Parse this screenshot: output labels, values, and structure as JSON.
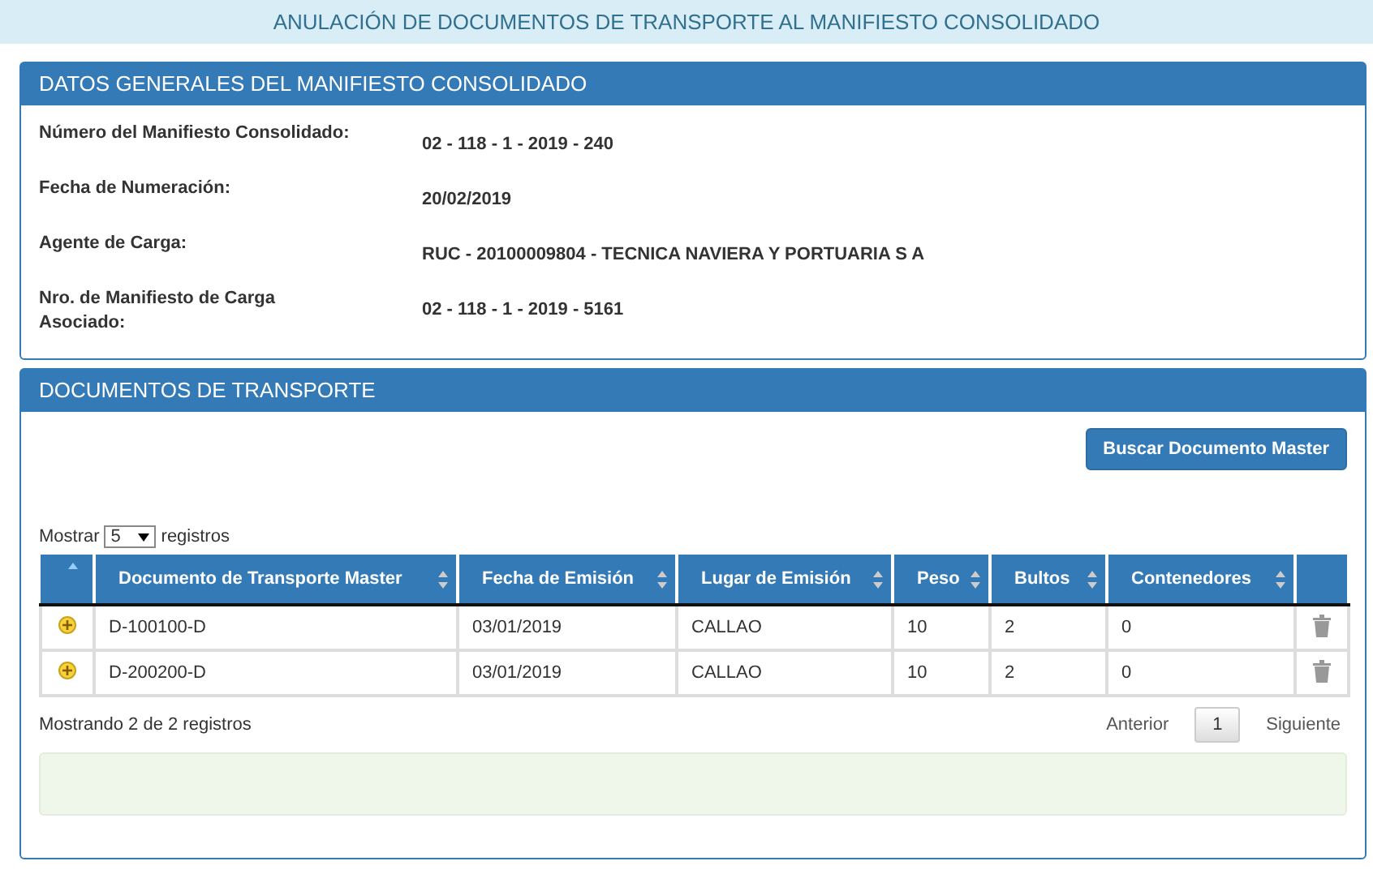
{
  "page_title": "ANULACIÓN DE DOCUMENTOS DE TRANSPORTE AL MANIFIESTO CONSOLIDADO",
  "general": {
    "heading": "DATOS GENERALES DEL MANIFIESTO CONSOLIDADO",
    "fields": [
      {
        "label": "Número del Manifiesto Consolidado:",
        "value": "02 - 118 - 1 - 2019 - 240"
      },
      {
        "label": "Fecha de Numeración:",
        "value": "20/02/2019"
      },
      {
        "label": "Agente de Carga:",
        "value": "RUC - 20100009804 - TECNICA NAVIERA Y PORTUARIA S A"
      },
      {
        "label": "Nro. de Manifiesto de Carga Asociado:",
        "value": "02 - 118 - 1 - 2019 - 5161"
      }
    ]
  },
  "documents": {
    "heading": "DOCUMENTOS DE TRANSPORTE",
    "search_button": "Buscar Documento Master",
    "length_menu": {
      "before": "Mostrar",
      "value": "5",
      "after": "registros"
    },
    "table": {
      "columns": [
        "Documento de Transporte Master",
        "Fecha de Emisión",
        "Lugar de Emisión",
        "Peso",
        "Bultos",
        "Contenedores"
      ],
      "rows": [
        {
          "cells": [
            "D-100100-D",
            "03/01/2019",
            "CALLAO",
            "10",
            "2",
            "0"
          ]
        },
        {
          "cells": [
            "D-200200-D",
            "03/01/2019",
            "CALLAO",
            "10",
            "2",
            "0"
          ]
        }
      ]
    },
    "info": "Mostrando 2 de 2 registros",
    "pagination": {
      "previous": "Anterior",
      "pages": [
        {
          "label": "1",
          "selected": true
        }
      ],
      "next": "Siguiente"
    }
  }
}
